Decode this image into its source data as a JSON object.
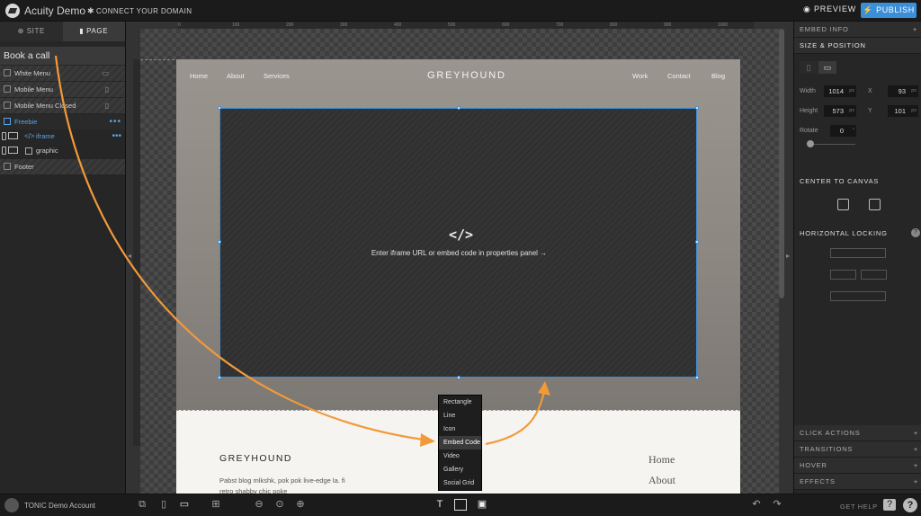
{
  "app": {
    "title": "Acuity Demo",
    "connect": "CONNECT YOUR DOMAIN",
    "preview": "PREVIEW",
    "publish": "PUBLISH"
  },
  "left_panel": {
    "tabs": [
      {
        "label": "SITE"
      },
      {
        "label": "PAGE"
      }
    ],
    "selected_item": "Book a call",
    "layers": [
      {
        "label": "White Menu",
        "device": "desktop"
      },
      {
        "label": "Mobile Menu",
        "device": "mobile"
      },
      {
        "label": "Mobile Menu Closed",
        "device": "mobile"
      },
      {
        "label": "Freebie"
      }
    ],
    "sublayers": [
      {
        "label": "iframe"
      },
      {
        "label": "graphic"
      }
    ],
    "footer_layer": "Footer"
  },
  "canvas": {
    "ruler_marks": [
      "0",
      "100",
      "200",
      "300",
      "400",
      "500",
      "600",
      "700",
      "800",
      "900",
      "1000"
    ],
    "nav_left": [
      "Home",
      "About",
      "Services"
    ],
    "brand": "GREYHOUND",
    "nav_right": [
      "Work",
      "Contact",
      "Blog"
    ],
    "embed_icon": "</>",
    "embed_text": "Enter iframe URL or embed code in properties panel →",
    "footer": {
      "brand": "GREYHOUND",
      "text": "Pabst blog mlkshk, pok pok live-edge la. fi retro shabby chic poke",
      "links": [
        "Home",
        "About"
      ]
    }
  },
  "add_menu": {
    "items": [
      "Rectangle",
      "Line",
      "Icon",
      "Embed Code",
      "Video",
      "Gallery",
      "Social Grid"
    ],
    "active": "Embed Code"
  },
  "right_panel": {
    "embed_info": "EMBED INFO",
    "size_position": "SIZE & POSITION",
    "width_label": "Width",
    "width": "1014",
    "height_label": "Height",
    "height": "573",
    "x_label": "X",
    "x": "93",
    "y_label": "Y",
    "y": "101",
    "rotate_label": "Rotate",
    "rotate": "0",
    "unit": "px",
    "deg": "°",
    "center_to_canvas": "CENTER TO CANVAS",
    "horizontal_locking": "HORIZONTAL LOCKING",
    "sections": [
      "CLICK ACTIONS",
      "TRANSITIONS",
      "HOVER",
      "EFFECTS"
    ]
  },
  "bottom": {
    "account": "TONIC Demo Account",
    "get_help": "GET HELP"
  },
  "colors": {
    "accent": "#3b8fd9",
    "annotation_arrow": "#f29a3a"
  }
}
